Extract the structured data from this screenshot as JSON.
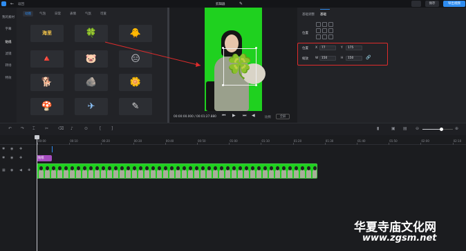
{
  "topbar": {
    "back_label": "返回",
    "project_title": "剪辑器",
    "save_label": "保存",
    "export_label": "导出视频",
    "accent": "#2e8cf0"
  },
  "left_nav": {
    "items": [
      {
        "label": "我的素材",
        "active": false
      },
      {
        "label": "字幕",
        "active": false
      },
      {
        "label": "贴纸",
        "active": true
      },
      {
        "label": "滤镜",
        "active": false
      },
      {
        "label": "转场",
        "active": false
      },
      {
        "label": "特效",
        "active": false
      }
    ]
  },
  "sticker_panel": {
    "tabs": [
      {
        "label": "动图",
        "active": true
      },
      {
        "label": "气泡",
        "active": false
      },
      {
        "label": "日常",
        "active": false
      },
      {
        "label": "表情",
        "active": false
      },
      {
        "label": "气氛",
        "active": false
      },
      {
        "label": "可爱",
        "active": false
      }
    ],
    "stickers": [
      {
        "icon": "text-sticker-icon",
        "glyph": "🎌"
      },
      {
        "icon": "clover-sticker-icon",
        "glyph": "🍀"
      },
      {
        "icon": "yellow-bird-sticker-icon",
        "glyph": "🐥"
      },
      {
        "icon": "yellow-triangle-face-sticker-icon",
        "glyph": "🔺"
      },
      {
        "icon": "white-pig-sticker-icon",
        "glyph": "🐷"
      },
      {
        "icon": "meh-face-sticker-icon",
        "glyph": "😑"
      },
      {
        "icon": "dog-banner-sticker-icon",
        "glyph": "🐕"
      },
      {
        "icon": "stone-sticker-icon",
        "glyph": "🪨"
      },
      {
        "icon": "white-flower-sticker-icon",
        "glyph": "🌼"
      },
      {
        "icon": "mushroom-sticker-icon",
        "glyph": "🍄"
      },
      {
        "icon": "plane-sticker-icon",
        "glyph": "✈"
      },
      {
        "icon": "text-scribble-sticker-icon",
        "glyph": "✎"
      }
    ],
    "sticker_text_1": "海里"
  },
  "preview": {
    "timecode": "00:00:00.000 / 00:01:27.880",
    "ratio_label": "比例",
    "fullscreen_label": "全屏",
    "background_color": "#1fd11f"
  },
  "properties": {
    "tabs": [
      {
        "label": "基础调整",
        "active": false
      },
      {
        "label": "基础",
        "active": true
      }
    ],
    "layout_label": "位置",
    "position": {
      "label": "位置",
      "x_label": "X",
      "x_value": "77",
      "y_label": "Y",
      "y_value": "175"
    },
    "size": {
      "label": "缩放",
      "w_label": "W",
      "w_value": "150",
      "h_label": "H",
      "h_value": "150"
    },
    "highlight_color": "#e02c2c"
  },
  "timeline": {
    "ticks": [
      "00:00",
      "00:10",
      "00:20",
      "00:30",
      "00:40",
      "00:50",
      "01:00",
      "01:10",
      "01:20",
      "01:30",
      "01:40",
      "01:50",
      "02:00",
      "02:10"
    ],
    "sticker_clip_label": "贴纸",
    "sticker_clip_color": "#a64dbf",
    "video_clip_color": "#1fd11f",
    "zoom_level": 0.6
  },
  "watermark": {
    "cn": "华夏寺庙文化网",
    "url": "www.zgsm.net"
  }
}
